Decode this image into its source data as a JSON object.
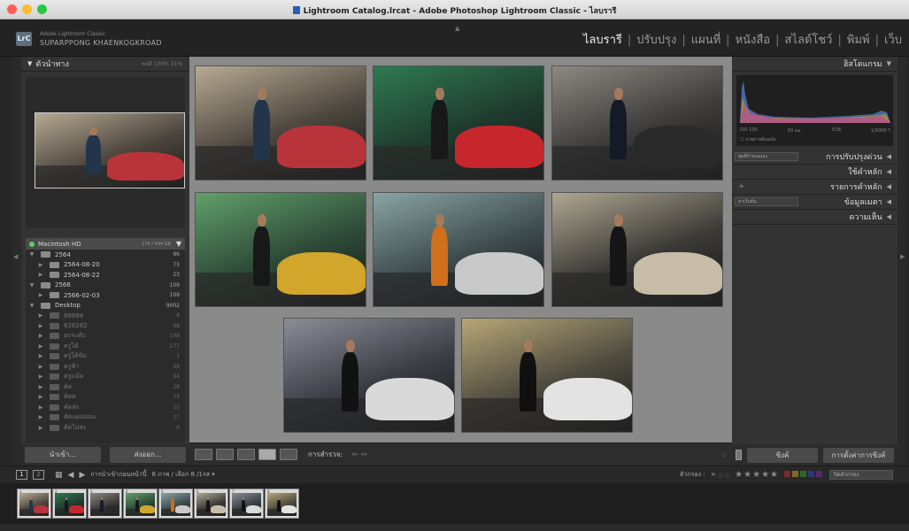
{
  "window": {
    "title": "Lightroom Catalog.lrcat - Adobe Photoshop Lightroom Classic - ไลบรารี",
    "traffic_light_colors": [
      "#fe5f57",
      "#febc2e",
      "#28c840"
    ]
  },
  "identity": {
    "logo": "LrC",
    "app_name": "Adobe Lightroom Classic",
    "user_name": "SUPARPPONG KHAENKOGKROAD"
  },
  "modules": {
    "items": [
      "ไลบรารี",
      "ปรับปรุง",
      "แผนที่",
      "หนังสือ",
      "สไลด์โชว์",
      "พิมพ์",
      "เว็บ"
    ],
    "active": "ไลบรารี",
    "separator": "|"
  },
  "navigator": {
    "title": "ตัวนำทาง",
    "zoom_levels": "พอดี  100%  31%"
  },
  "folders": {
    "volume": {
      "name": "Macintosh HD",
      "size": "179 / 494 GB"
    },
    "items": [
      {
        "name": "2564",
        "count": "96",
        "indent": 0,
        "expanded": true,
        "dim": false
      },
      {
        "name": "2564-08-20",
        "count": "73",
        "indent": 1,
        "expanded": false,
        "dim": false
      },
      {
        "name": "2564-08-22",
        "count": "23",
        "indent": 1,
        "expanded": false,
        "dim": false
      },
      {
        "name": "2566",
        "count": "109",
        "indent": 0,
        "expanded": true,
        "dim": false
      },
      {
        "name": "2566-02-03",
        "count": "109",
        "indent": 1,
        "expanded": false,
        "dim": false
      },
      {
        "name": "Desktop",
        "count": "9002",
        "indent": 0,
        "expanded": true,
        "dim": false
      },
      {
        "name": "88888",
        "count": "8",
        "indent": 1,
        "expanded": false,
        "dim": true
      },
      {
        "name": "626262",
        "count": "98",
        "indent": 1,
        "expanded": false,
        "dim": true
      },
      {
        "name": "ยกระดับ",
        "count": "108",
        "indent": 1,
        "expanded": false,
        "dim": true
      },
      {
        "name": "ครูได้",
        "count": "277",
        "indent": 1,
        "expanded": false,
        "dim": true
      },
      {
        "name": "ครูได้ขับ",
        "count": "3",
        "indent": 1,
        "expanded": false,
        "dim": true
      },
      {
        "name": "ครูฟ้า",
        "count": "48",
        "indent": 1,
        "expanded": false,
        "dim": true
      },
      {
        "name": "ครูแม้ม",
        "count": "94",
        "indent": 1,
        "expanded": false,
        "dim": true
      },
      {
        "name": "คัด",
        "count": "28",
        "indent": 1,
        "expanded": false,
        "dim": true
      },
      {
        "name": "คัดด",
        "count": "74",
        "indent": 1,
        "expanded": false,
        "dim": true
      },
      {
        "name": "คัดส่ง",
        "count": "10",
        "indent": 1,
        "expanded": false,
        "dim": true
      },
      {
        "name": "คัดแผนปอน",
        "count": "17",
        "indent": 1,
        "expanded": false,
        "dim": true
      },
      {
        "name": "คัดไปส่ง",
        "count": "6",
        "indent": 1,
        "expanded": false,
        "dim": true
      }
    ]
  },
  "left_buttons": {
    "import": "นำเข้า...",
    "export": "ส่งออก..."
  },
  "toolbar": {
    "survey_label": "การสำรวจ:",
    "arrows": "⇦ ⇨"
  },
  "right_panel": {
    "histogram_title": "ฮิสโตแกรม",
    "stats": [
      "ISO 100",
      "50 มม.",
      "f/18",
      "1/5000 วิ"
    ],
    "original_photo": "ภาพถ่ายต้นฉบับ",
    "sections": [
      {
        "label": "การปรับปรุงด่วน",
        "control": "select",
        "control_text": "ชุดที่กำหนดเอง"
      },
      {
        "label": "ใช้คำหลัก",
        "control": "none",
        "control_text": ""
      },
      {
        "label": "รายการคำหลัก",
        "control": "plus",
        "control_text": "+"
      },
      {
        "label": "ข้อมูลเมตา",
        "control": "select",
        "control_text": "ค่าเริ่มต้น"
      },
      {
        "label": "ความเห็น",
        "control": "none",
        "control_text": ""
      }
    ],
    "sync_button": "ซิงค์",
    "sync_settings_button": "การตั้งค่าการซิงค์"
  },
  "filmstrip_bar": {
    "screen1": "1",
    "screen2": "2",
    "source_label": "การนำเข้าก่อนหน้านี้",
    "selection_info": "8 ภาพ / เลือก 8 /1รส ▾",
    "filter_label": "ตัวกรอง :",
    "stars": "★★★★★",
    "filter_dropdown": "ปิดตัวกรอง"
  },
  "photos": [
    {
      "name": "photo-1",
      "bg": "#4d463e",
      "light": "#b7aa94",
      "car": "#b8343a",
      "shirt": "#22354a"
    },
    {
      "name": "photo-2",
      "bg": "#1f3a2e",
      "light": "#2f7a52",
      "car": "#c8262d",
      "shirt": "#181818"
    },
    {
      "name": "photo-3",
      "bg": "#3c3b3a",
      "light": "#8d8882",
      "car": "#2a2a2a",
      "shirt": "#141a26"
    },
    {
      "name": "photo-4",
      "bg": "#2e4a38",
      "light": "#61a06a",
      "car": "#d1a62a",
      "shirt": "#181818"
    },
    {
      "name": "photo-5",
      "bg": "#3d4a4c",
      "light": "#8aa4a4",
      "car": "#c9c9c9",
      "shirt": "#d06f1c"
    },
    {
      "name": "photo-6",
      "bg": "#3b3a36",
      "light": "#b0a892",
      "car": "#c7bca7",
      "shirt": "#151515"
    },
    {
      "name": "photo-7",
      "bg": "#3a3d44",
      "light": "#8b8e98",
      "car": "#d9d9d9",
      "shirt": "#121212"
    },
    {
      "name": "photo-8",
      "bg": "#4e4a3e",
      "light": "#b7a778",
      "car": "#e3e3e3",
      "shirt": "#101010"
    }
  ]
}
